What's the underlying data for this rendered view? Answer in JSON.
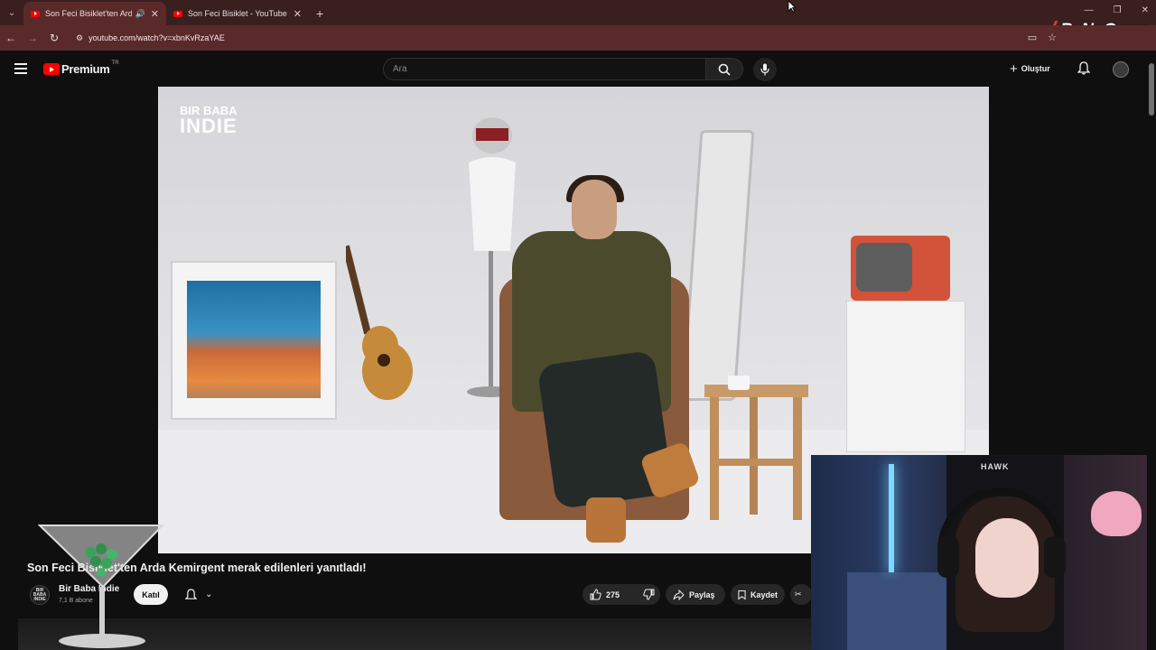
{
  "browser": {
    "tabs": [
      {
        "title": "Son Feci Bisiklet'ten Arda K",
        "active": true,
        "audio": "🔊"
      },
      {
        "title": "Son Feci Bisiklet - YouTube",
        "active": false
      }
    ],
    "new_tab": "+",
    "url": "youtube.com/watch?v=xbnKvRzaYAE",
    "overlay_brand": "ByNoGame"
  },
  "youtube": {
    "logo_text": "Premium",
    "region": "TR",
    "search_placeholder": "Ara",
    "create_label": "Oluştur"
  },
  "video": {
    "watermark_line1": "BIR BABA",
    "watermark_line2": "INDIE",
    "title": "Son Feci Bisiklet'ten Arda Kemirgent merak edilenleri yanıtladı!",
    "channel": {
      "name": "Bir Baba Indie",
      "subscribers": "7,1 B abone",
      "avatar_text": "BIR BABA INDIE"
    },
    "join_label": "Katıl",
    "likes": "275",
    "share_label": "Paylaş",
    "save_label": "Kaydet"
  },
  "webcam": {
    "chair_brand": "HAWK"
  },
  "colors": {
    "tab_bar": "#3a1f1f",
    "address_bar": "#5a2a2a",
    "page_bg": "#0f0f0f",
    "youtube_red": "#ff0000"
  }
}
